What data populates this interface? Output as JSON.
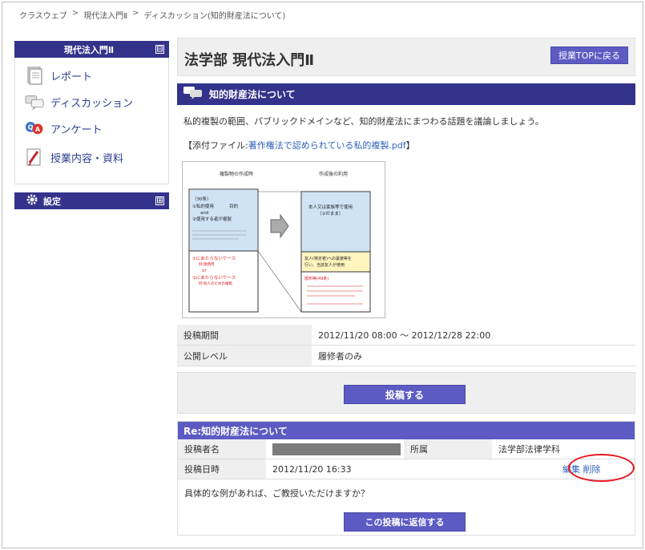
{
  "breadcrumb": {
    "items": [
      "クラスウェブ",
      "現代法入門Ⅱ",
      "ディスカッション(知的財産法について)"
    ],
    "sep": ">"
  },
  "sidebar": {
    "course_title": "現代法入門Ⅱ",
    "collapse_glyph": "⊟",
    "items": [
      {
        "label": "レポート",
        "icon": "report-icon"
      },
      {
        "label": "ディスカッション",
        "icon": "discussion-icon"
      },
      {
        "label": "アンケート",
        "icon": "survey-icon"
      },
      {
        "label": "授業内容・資料",
        "icon": "materials-icon"
      }
    ],
    "settings_title": "設定",
    "expand_glyph": "⊞"
  },
  "main": {
    "page_title": "法学部 現代法入門Ⅱ",
    "top_button": "授業TOPに戻る",
    "discussion_title": "知的財産法について",
    "description": "私的複製の範囲、パブリックドメインなど、知的財産法にまつわる話題を議論しましょう。",
    "attachment_prefix": "【添付ファイル:",
    "attachment_link": "著作権法で認められている私的複製.pdf",
    "attachment_suffix": "】",
    "diagram": {
      "left_title": "複製物の作成時",
      "right_title": "作成後の利用",
      "left_top_1": "（30条）",
      "left_top_2": "①私的使用",
      "left_top_2b": "目的",
      "left_top_3": "and",
      "left_top_4": "②使用する者が複製",
      "left_bottom_1": "①にあたらないケース",
      "left_bottom_2": "例:業務用",
      "left_bottom_3": "or",
      "left_bottom_4": "②にあたらないケース",
      "left_bottom_5": "例:他人のための複製",
      "right_top_1": "本人又は家族等で使用",
      "right_top_2": "（①のまま）",
      "right_mid_1": "友人(特定者)への譲渡等を",
      "right_mid_2": "行い、当該友人が使用",
      "right_bottom_1": "頒布等(49条)"
    },
    "info": [
      {
        "label": "投稿期間",
        "value": "2012/11/20 08:00 〜 2012/12/28 22:00"
      },
      {
        "label": "公開レベル",
        "value": "履修者のみ"
      }
    ],
    "post_button": "投稿する"
  },
  "reply": {
    "title": "Re:知的財産法について",
    "author_label": "投稿者名",
    "affiliation_label": "所属",
    "affiliation_value": "法学部法律学科",
    "date_label": "投稿日時",
    "date_value": "2012/11/20 16:33",
    "edit": "編集",
    "delete": "削除",
    "body": "具体的な例があれば、ご教授いただけますか？",
    "reply_button": "この投稿に返信する"
  },
  "colors": {
    "nav_dark": "#33338c",
    "button": "#5b5bc3",
    "link": "#2d63b8",
    "highlight_ring": "#e8141b"
  }
}
